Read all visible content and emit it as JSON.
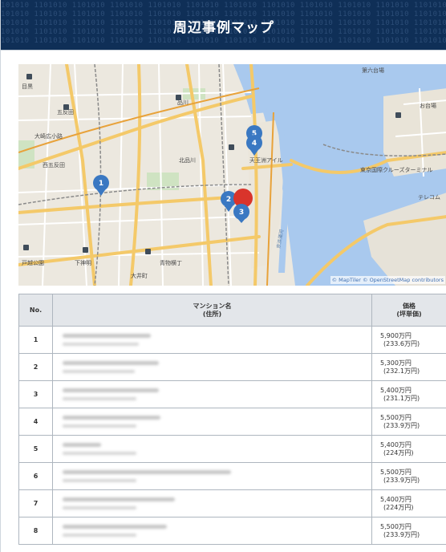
{
  "header": {
    "title": "周辺事例マップ",
    "pattern": "101010 1101010 1101010 1101010 1101010 1101010 1101010 1101010 1101010 1101010 1101010 1101010"
  },
  "map": {
    "credit": "© MapTiler © OpenStreetMap contributors",
    "labels": {
      "daiba": "第六台場",
      "gotanda": "五反田",
      "osaki": "大崎広小路",
      "nishigotanda": "西五反田",
      "shinagawa": "品川",
      "kitashinagawa": "北品川",
      "tennozu": "天王洲アイル",
      "cruise": "東京国際クルーズターミナル",
      "terecomu": "テレコム",
      "odaiba": "お台場",
      "togoshi": "戸越公園",
      "shimoshinmei": "下神明",
      "aomono": "青物横丁",
      "oimachi": "大井町",
      "meguro": "目黒",
      "keihin": "京浜運河"
    },
    "markers": [
      "1",
      "2",
      "3",
      "4",
      "5"
    ]
  },
  "table": {
    "headers": {
      "no": "No.",
      "name_line1": "マンション名",
      "name_line2": "(住所)",
      "price_line1": "価格",
      "price_line2": "(坪単価)"
    },
    "rows": [
      {
        "no": "1",
        "price": "5,900万円",
        "tsubo": "(233.6万円)"
      },
      {
        "no": "2",
        "price": "5,300万円",
        "tsubo": "(232.1万円)"
      },
      {
        "no": "3",
        "price": "5,400万円",
        "tsubo": "(231.1万円)"
      },
      {
        "no": "4",
        "price": "5,500万円",
        "tsubo": "(233.9万円)"
      },
      {
        "no": "5",
        "price": "5,400万円",
        "tsubo": "(224万円)"
      },
      {
        "no": "6",
        "price": "5,500万円",
        "tsubo": "(233.9万円)"
      },
      {
        "no": "7",
        "price": "5,400万円",
        "tsubo": "(224万円)"
      },
      {
        "no": "8",
        "price": "5,500万円",
        "tsubo": "(233.9万円)"
      }
    ]
  },
  "colors": {
    "banner": "#0f2f57",
    "marker_blue": "#3a78c2",
    "marker_red": "#d9342b",
    "water": "#a9c9ee",
    "road_major": "#f4c969"
  }
}
